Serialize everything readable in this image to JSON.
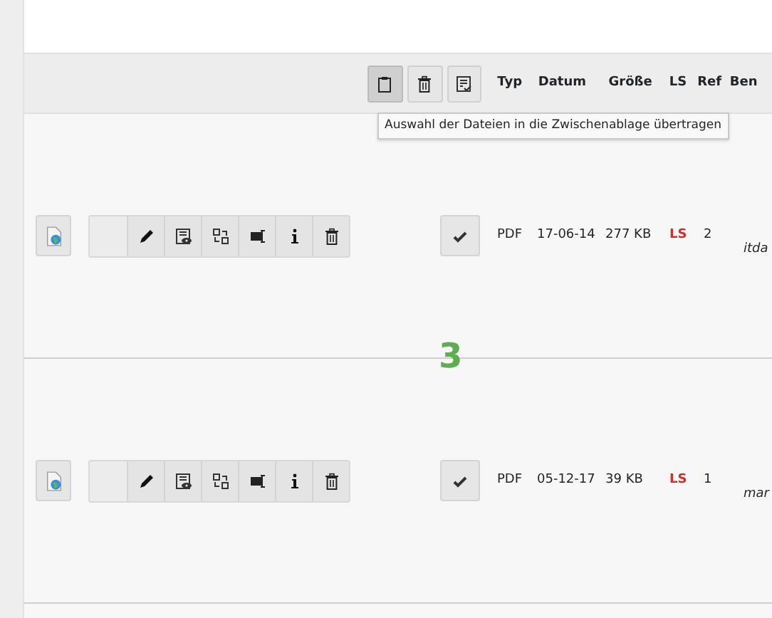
{
  "toolbar": [
    {
      "kind": "clipboard",
      "selected": true
    },
    {
      "kind": "trash",
      "selected": false
    },
    {
      "kind": "checklist",
      "selected": false
    }
  ],
  "columns": [
    "Typ",
    "Datum",
    "Größe",
    "LS",
    "Ref",
    "Ben"
  ],
  "tooltip": "Auswahl der Dateien in die Zwischenablage übertragen",
  "rows": [
    {
      "type": "PDF",
      "date": "17-06-14",
      "size": "277 KB",
      "ls": "LS",
      "ref": "2",
      "owner": "itda"
    },
    {
      "type": "PDF",
      "date": "05-12-17",
      "size": "39 KB",
      "ls": "LS",
      "ref": "1",
      "owner": "mar"
    }
  ],
  "marker": "3"
}
